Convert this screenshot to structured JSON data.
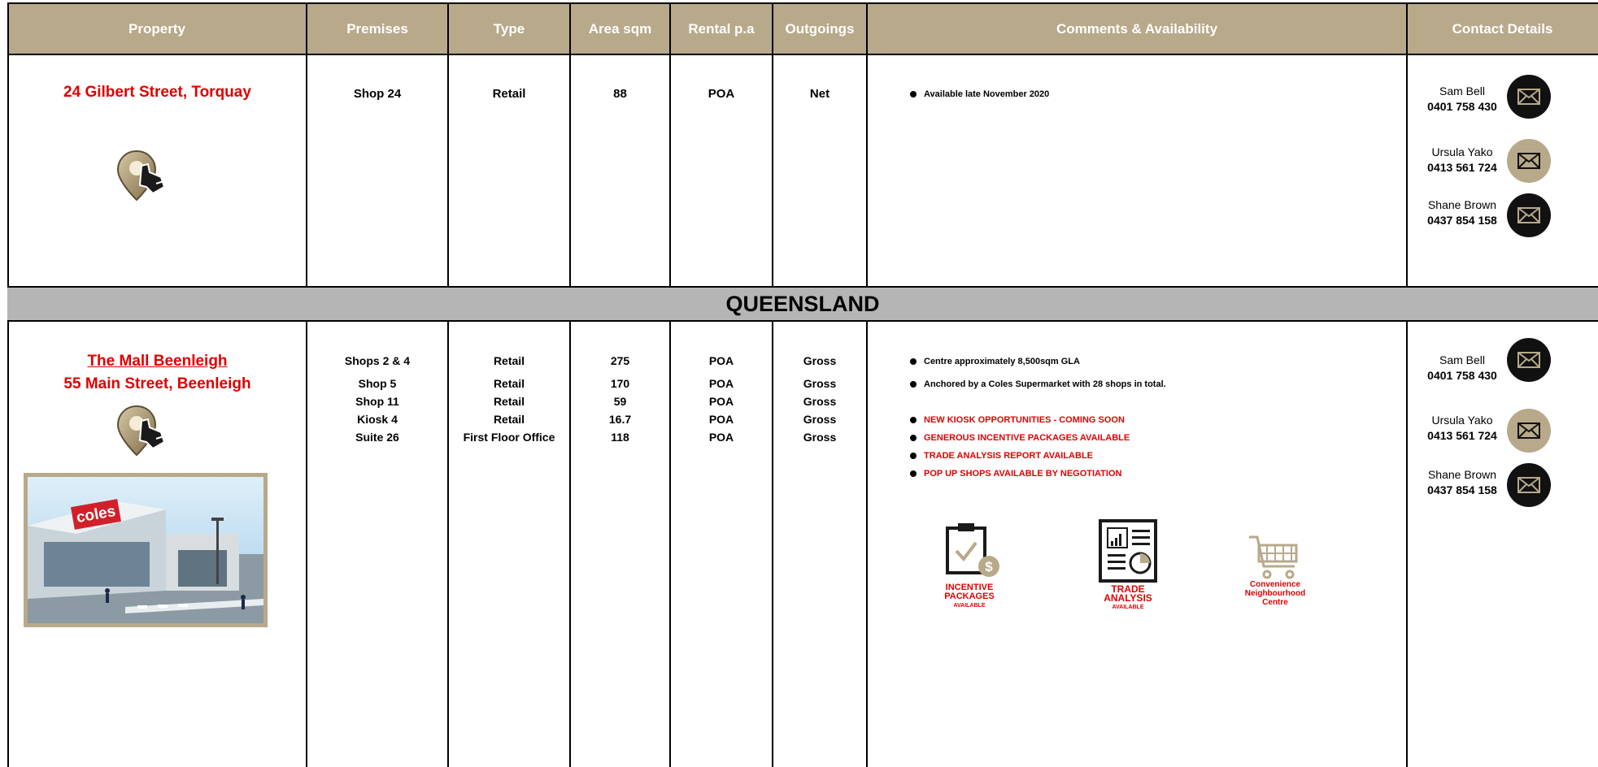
{
  "columns": [
    "Property",
    "Premises",
    "Type",
    "Area sqm",
    "Rental p.a",
    "Outgoings",
    "Comments & Availability",
    "Contact Details"
  ],
  "listing1": {
    "property": "24 Gilbert Street, Torquay",
    "premises": "Shop 24",
    "type": "Retail",
    "area": "88",
    "rental": "POA",
    "outgoings": "Net",
    "comments": [
      "Available late November 2020"
    ]
  },
  "section_title": "QUEENSLAND",
  "listing2": {
    "property_name": "The Mall Beenleigh",
    "property_address": "55 Main Street, Beenleigh",
    "rows": [
      {
        "premises": "Shops 2 & 4",
        "type": "Retail",
        "area": "275",
        "rental": "POA",
        "outgoings": "Gross"
      },
      {
        "premises": "Shop 5",
        "type": "Retail",
        "area": "170",
        "rental": "POA",
        "outgoings": "Gross"
      },
      {
        "premises": "Shop 11",
        "type": "Retail",
        "area": "59",
        "rental": "POA",
        "outgoings": "Gross"
      },
      {
        "premises": "Kiosk 4",
        "type": "Retail",
        "area": "16.7",
        "rental": "POA",
        "outgoings": "Gross"
      },
      {
        "premises": "Suite 26",
        "type": "First Floor Office",
        "area": "118",
        "rental": "POA",
        "outgoings": "Gross"
      }
    ],
    "comments": [
      "Centre approximately 8,500sqm GLA",
      "Anchored by a Coles Supermarket with 28 shops in total."
    ],
    "highlights": [
      "NEW KIOSK OPPORTUNITIES - COMING SOON",
      "GENEROUS INCENTIVE PACKAGES AVAILABLE",
      "TRADE ANALYSIS REPORT AVAILABLE",
      "POP UP SHOPS AVAILABLE BY NEGOTIATION"
    ],
    "photo_sign": "coles",
    "services": [
      {
        "line1": "INCENTIVE",
        "line2": "PACKAGES",
        "line3": "AVAILABLE"
      },
      {
        "line1": "TRADE",
        "line2": "ANALYSIS",
        "line3": "AVAILABLE"
      },
      {
        "line1": "Convenience",
        "line2": "Neighbourhood",
        "line3": "Centre"
      }
    ]
  },
  "contacts": [
    {
      "name": "Sam Bell",
      "phone": "0401 758 430",
      "icon": "mail-icon",
      "icon_bg": "#111111"
    },
    {
      "name": "Ursula Yako",
      "phone": "0413 561 724",
      "icon": "mail-icon",
      "icon_bg": "#b7a98a"
    },
    {
      "name": "Shane Brown",
      "phone": "0437 854 158",
      "icon": "mail-icon",
      "icon_bg": "#111111"
    }
  ],
  "colors": {
    "header_bg": "#b7a98a",
    "header_text": "#ffffff",
    "accent_red": "#e00000",
    "banner_bg": "#b5b5b5",
    "border": "#000000"
  }
}
